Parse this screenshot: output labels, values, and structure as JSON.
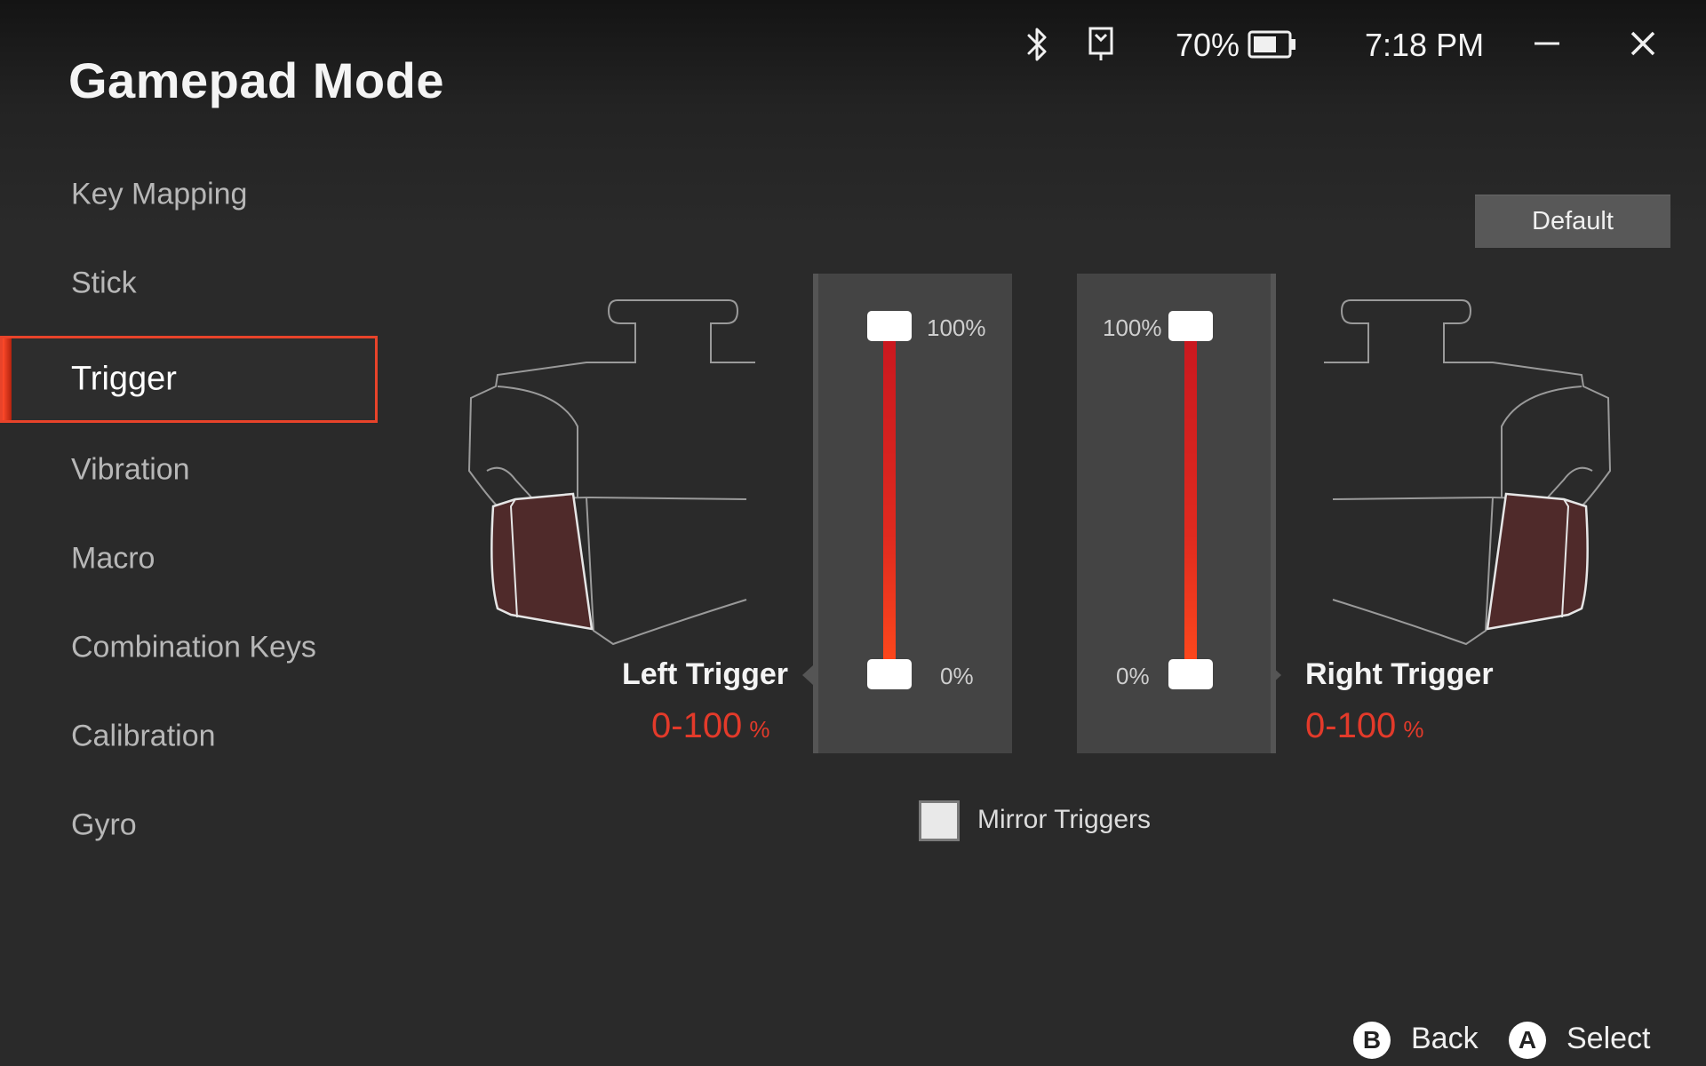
{
  "window": {
    "title": "Gamepad Mode"
  },
  "status": {
    "bluetooth_icon": "bluetooth-icon",
    "device_icon": "controller-icon",
    "battery_percent": "70%",
    "battery_level": 0.7,
    "time": "7:18 PM",
    "minimize_icon": "minimize-icon",
    "close_icon": "close-icon"
  },
  "sidebar": {
    "items": [
      {
        "label": "Key Mapping"
      },
      {
        "label": "Stick"
      },
      {
        "label": "Trigger",
        "active": true
      },
      {
        "label": "Vibration"
      },
      {
        "label": "Macro"
      },
      {
        "label": "Combination Keys"
      },
      {
        "label": "Calibration"
      },
      {
        "label": "Gyro"
      }
    ]
  },
  "main": {
    "default_label": "Default",
    "left": {
      "label": "Left Trigger",
      "range": "0-100",
      "unit": "%",
      "top_pct": "100%",
      "bottom_pct": "0%",
      "min": 0,
      "max": 100
    },
    "right": {
      "label": "Right Trigger",
      "range": "0-100",
      "unit": "%",
      "top_pct": "100%",
      "bottom_pct": "0%",
      "min": 0,
      "max": 100
    },
    "mirror_label": "Mirror Triggers",
    "mirror_checked": false
  },
  "footer": {
    "back_key": "B",
    "back_label": "Back",
    "select_key": "A",
    "select_label": "Select"
  },
  "colors": {
    "accent": "#e8432a",
    "track": "#e02a1f",
    "background": "#2a2a2a",
    "panel": "#444444",
    "trigger_fill": "#4f2a2a"
  }
}
